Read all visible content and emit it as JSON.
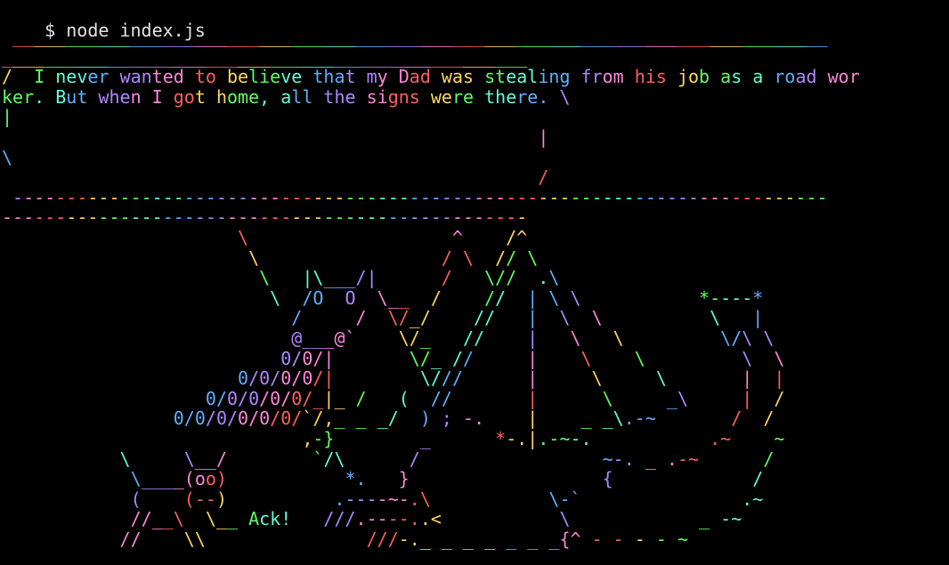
{
  "terminal": {
    "prompt": "$ node index.js",
    "palette": [
      "#ff5f5f",
      "#ffd75f",
      "#5fff5f",
      "#5fffd7",
      "#5fafff",
      "#af87ff",
      "#ff87d7"
    ],
    "prompt_color": "#e4e4e4",
    "background": "#000000"
  },
  "output": [
    " ____________________________________________________________________________",
    "_________________________________________________",
    "/  I never wanted to believe that my Dad was stealing from his job as a road wor",
    "ker. But when I got home, all the signs were there. \\",
    "|",
    "                                                  |",
    "\\",
    "                                                  /",
    " ----------------------------------------------------------------------------",
    "-------------------------------------------------",
    "                      \\                   ^    /^",
    "                       \\                 / \\  // \\",
    "                        \\   |\\___/|      /   \\//  .\\",
    "                         \\  /O  O  \\__  /    //  | \\ \\           *----*",
    "                           /     /  \\/_/    //   |  \\  \\          \\   |",
    "                           @___@`    \\/_   //    |   \\   \\         \\/\\ \\",
    "                          0/0/|       \\/_ //     |    \\    \\         \\  \\",
    "                      0/0/0/0/|        \\///      |     \\     \\       |  |",
    "                   0/0/0/0/0/_|_ /   (  //       |      \\     _\\     |  /",
    "                0/0/0/0/0/0/`/,_ _ _/  ) ; -.    |    _ _\\.-~       /  /",
    "                            ,-}        _      *-.|.-~-.           .~    ~",
    "           \\     \\__/        `/\\      /                 ~-. _ .-~      /",
    "            \\____(oo)           *.   }                  {             /",
    "            (    (--)          .----~-.\\           \\-`               .~",
    "            //__\\  \\__ Ack!   ///.----..<           \\            _ -~",
    "           //    \\\\               ///-._ _ _ _ _ _ _{^ - - - - ~"
  ]
}
